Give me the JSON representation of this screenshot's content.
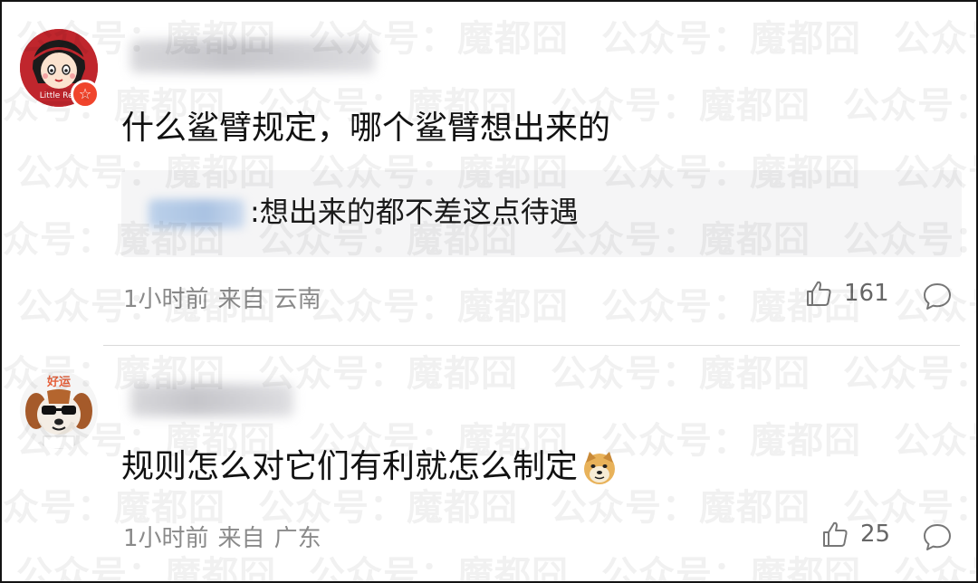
{
  "watermark": {
    "text": "公众号：魔都囧"
  },
  "comments": [
    {
      "avatar_icon": "red-cartoon-girl-avatar",
      "avatar_caption": "Little Red",
      "badge_icon": "star-badge-icon",
      "text": "什么鲨臂规定，哪个鲨臂想出来的",
      "reply": {
        "text": ":想出来的都不差这点待遇"
      },
      "meta": {
        "time": "1小时前",
        "from": "来自",
        "location": "云南"
      },
      "likes": "161"
    },
    {
      "avatar_icon": "dog-sunglasses-avatar",
      "avatar_caption": "好运",
      "text": "规则怎么对它们有利就怎么制定",
      "emoji": "doge-emoji",
      "meta": {
        "time": "1小时前",
        "from": "来自",
        "location": "广东"
      },
      "likes": "25"
    }
  ],
  "colors": {
    "accent_badge": "#f0442c",
    "meta_text": "#8a8a8a",
    "reply_bg": "#f5f5f6"
  }
}
